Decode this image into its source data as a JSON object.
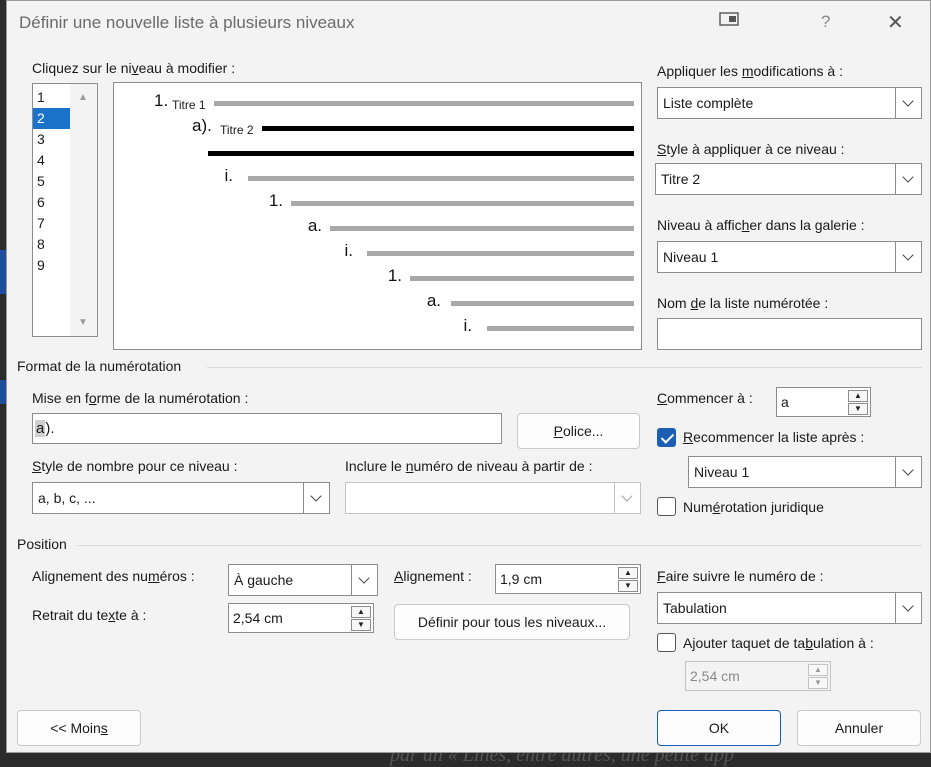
{
  "dialog": {
    "title": "Définir une nouvelle liste à plusieurs niveaux",
    "help": "?",
    "close": "✕"
  },
  "levels": {
    "label_a": "Cliquez sur le ni",
    "label_u": "v",
    "label_b": "eau à modifier :",
    "items": [
      "1",
      "2",
      "3",
      "4",
      "5",
      "6",
      "7",
      "8",
      "9"
    ],
    "selected": "2"
  },
  "preview": {
    "rows": [
      {
        "num": "1.",
        "title": "Titre 1"
      },
      {
        "num": "a).",
        "title": "Titre 2"
      },
      {
        "num": "",
        "title": ""
      },
      {
        "num": "i.",
        "title": ""
      },
      {
        "num": "1.",
        "title": ""
      },
      {
        "num": "a.",
        "title": ""
      },
      {
        "num": "i.",
        "title": ""
      },
      {
        "num": "1.",
        "title": ""
      },
      {
        "num": "a.",
        "title": ""
      },
      {
        "num": "i.",
        "title": ""
      }
    ]
  },
  "apply": {
    "label_a": "Appliquer les ",
    "label_u": "m",
    "label_b": "odifications à :",
    "value": "Liste complète"
  },
  "style_level": {
    "label_u": "S",
    "label_b": "tyle à appliquer à ce niveau :",
    "value": "Titre 2"
  },
  "gallery": {
    "label_a": "Niveau à affic",
    "label_u": "h",
    "label_b": "er dans la galerie :",
    "value": "Niveau 1"
  },
  "list_name": {
    "label_a": "Nom ",
    "label_u": "d",
    "label_b": "e la liste numérotée :",
    "value": ""
  },
  "numbering": {
    "section": "Format de la numérotation",
    "format_label_a": "Mise en f",
    "format_label_u": "o",
    "format_label_b": "rme de la numérotation :",
    "format_highlight": "a",
    "format_rest": ").",
    "font_button_u": "P",
    "font_button_b": "olice...",
    "numstyle_label_u": "S",
    "numstyle_label_b": "tyle de nombre pour ce niveau :",
    "numstyle_value": "a, b, c, ...",
    "include_label_a": "Inclure le ",
    "include_label_u": "n",
    "include_label_b": "uméro de niveau à partir de :",
    "include_value": "",
    "start_label_u": "C",
    "start_label_b": "ommencer à :",
    "start_value": "a",
    "restart_label_u": "R",
    "restart_label_b": "ecommencer la liste après :",
    "restart_checked": true,
    "restart_value": "Niveau 1",
    "legal_label_a": "Num",
    "legal_label_u": "é",
    "legal_label_b": "rotation juridique",
    "legal_checked": false
  },
  "position": {
    "section": "Position",
    "align_label_a": "Alignement des nu",
    "align_label_u": "m",
    "align_label_b": "éros :",
    "align_value": "À gauche",
    "at_label_u": "A",
    "at_label_b": "lignement :",
    "at_value": "1,9 cm",
    "indent_label_a": "Retrait du te",
    "indent_label_u": "x",
    "indent_label_b": "te à :",
    "indent_value": "2,54 cm",
    "all_levels_button": "Définir pour tous les niveaux...",
    "follow_label_u": "F",
    "follow_label_b": "aire suivre le numéro de :",
    "follow_value": "Tabulation",
    "tabstop_label_a": "Ajouter taquet de ta",
    "tabstop_label_u": "b",
    "tabstop_label_b": "ulation à :",
    "tabstop_checked": false,
    "tabstop_value": "2,54 cm"
  },
  "buttons": {
    "less_a": "<< Moin",
    "less_u": "s",
    "ok": "OK",
    "cancel": "Annuler"
  },
  "background_text": "par un « Lines, entre autres, une petite app"
}
